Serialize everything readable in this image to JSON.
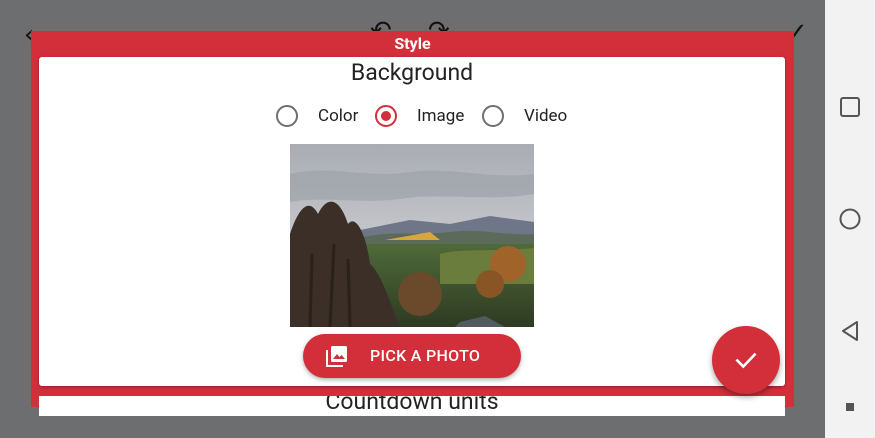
{
  "dialog": {
    "title": "Style",
    "section_title": "Background",
    "radios": [
      {
        "label": "Color",
        "selected": false
      },
      {
        "label": "Image",
        "selected": true
      },
      {
        "label": "Video",
        "selected": false
      }
    ],
    "pick_button_label": "PICK A PHOTO",
    "next_section_partial": "Countdown units"
  },
  "colors": {
    "accent": "#d32f3b",
    "app_background": "#6d6e70",
    "nav_bar": "#f2f2f2"
  },
  "icons": {
    "fab": "check-icon",
    "pick": "photo-library-icon",
    "nav": [
      "recents-square-icon",
      "home-circle-icon",
      "back-triangle-icon",
      "menu-dot-icon"
    ]
  }
}
